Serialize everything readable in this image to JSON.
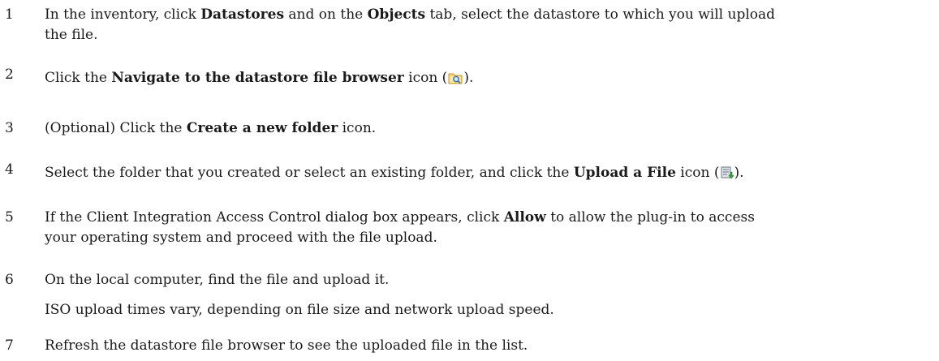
{
  "steps": [
    {
      "number": "1",
      "line1_a": "In the inventory, click ",
      "line1_b": "Datastores",
      "line1_c": " and on the ",
      "line1_d": "Objects",
      "line1_e": " tab, select the datastore to which you will upload",
      "line2": "the file."
    },
    {
      "number": "2",
      "a": "Click the ",
      "b": "Navigate to the datastore file browser",
      "c": " icon (",
      "icon": "datastore-browser-icon",
      "d": ")."
    },
    {
      "number": "3",
      "a": "(Optional) Click the ",
      "b": "Create a new folder",
      "c": " icon."
    },
    {
      "number": "4",
      "a": "Select the folder that you created or select an existing folder, and click the ",
      "b": "Upload a File",
      "c": " icon (",
      "icon": "upload-file-icon",
      "d": ")."
    },
    {
      "number": "5",
      "a": "If the Client Integration Access Control dialog box appears, click ",
      "b": "Allow",
      "c": " to allow the plug-in to access",
      "line2": "your operating system and proceed with the file upload."
    },
    {
      "number": "6",
      "text": "On the local computer, find the file and upload it.",
      "note": "ISO upload times vary, depending on file size and network upload speed."
    },
    {
      "number": "7",
      "text": "Refresh the datastore file browser to see the uploaded file in the list."
    }
  ]
}
